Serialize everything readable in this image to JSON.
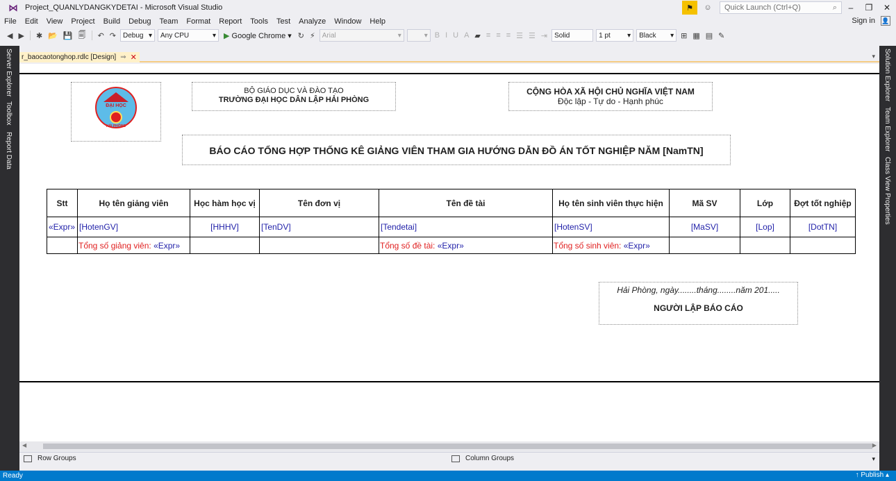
{
  "window": {
    "title": "Project_QUANLYDANGKYDETAI - Microsoft Visual Studio",
    "quick_launch_placeholder": "Quick Launch (Ctrl+Q)",
    "controls": {
      "minimize": "–",
      "maximize": "❐",
      "close": "✕"
    }
  },
  "menu": {
    "items": [
      "File",
      "Edit",
      "View",
      "Project",
      "Build",
      "Debug",
      "Team",
      "Format",
      "Report",
      "Tools",
      "Test",
      "Analyze",
      "Window",
      "Help"
    ],
    "sign_in": "Sign in"
  },
  "toolbar": {
    "config": "Debug",
    "platform": "Any CPU",
    "run_target": "Google Chrome",
    "font": "Arial",
    "line_style": "Solid",
    "line_width": "1 pt",
    "line_color": "Black"
  },
  "left_rail": [
    "Server Explorer",
    "Toolbox",
    "Report Data"
  ],
  "right_rail": [
    "Solution Explorer",
    "Team Explorer",
    "Class View",
    "Properties"
  ],
  "tab": {
    "label": "r_baocaotonghop.rdlc [Design]"
  },
  "report": {
    "header_left": {
      "line1": "BỘ GIÁO DỤC VÀ ĐÀO TẠO",
      "line2": "TRƯỜNG ĐẠI HỌC DÂN LẬP HẢI PHÒNG"
    },
    "header_right": {
      "line1": "CỘNG HÒA XÃ HỘI CHỦ NGHĨA VIỆT NAM",
      "line2": "Độc lập - Tự do - Hạnh phúc"
    },
    "logo": {
      "top_text": "ĐẠI HỌC",
      "bottom_text": "HẢI PHÒNG"
    },
    "title": "BÁO CÁO TỔNG HỢP THỐNG KÊ GIẢNG VIÊN THAM GIA HƯỚNG DẪN ĐỒ ÁN TỐT NGHIỆP NĂM [NamTN]",
    "table": {
      "headers": [
        "Stt",
        "Họ tên giảng viên",
        "Học hàm học vị",
        "Tên đơn vị",
        "Tên đề tài",
        "Họ tên sinh viên thực hiện",
        "Mã SV",
        "Lớp",
        "Đợt tốt nghiệp"
      ],
      "data_row": [
        "«Expr»",
        "[HotenGV]",
        "[HHHV]",
        "[TenDV]",
        "[Tendetai]",
        "[HotenSV]",
        "[MaSV]",
        "[Lop]",
        "[DotTN]"
      ],
      "totals": {
        "gv_label": "Tổng số giảng viên: ",
        "gv_expr": "«Expr»",
        "dt_label": "Tổng số đề tài: ",
        "dt_expr": "«Expr»",
        "sv_label": "Tổng số sinh viên: ",
        "sv_expr": "«Expr»"
      }
    },
    "signature": {
      "date": "Hải Phòng, ngày........tháng........năm 201.....",
      "title": "NGƯỜI LẬP BÁO CÁO"
    }
  },
  "grouping": {
    "row_groups": "Row Groups",
    "column_groups": "Column Groups"
  },
  "status": {
    "text": "Ready",
    "publish": "Publish"
  },
  "colors": {
    "status_bar": "#007acc",
    "rail": "#2d2d30",
    "expr_blue": "#1f1fa8",
    "label_red": "#e02020",
    "active_tab": "#fff1c9"
  }
}
